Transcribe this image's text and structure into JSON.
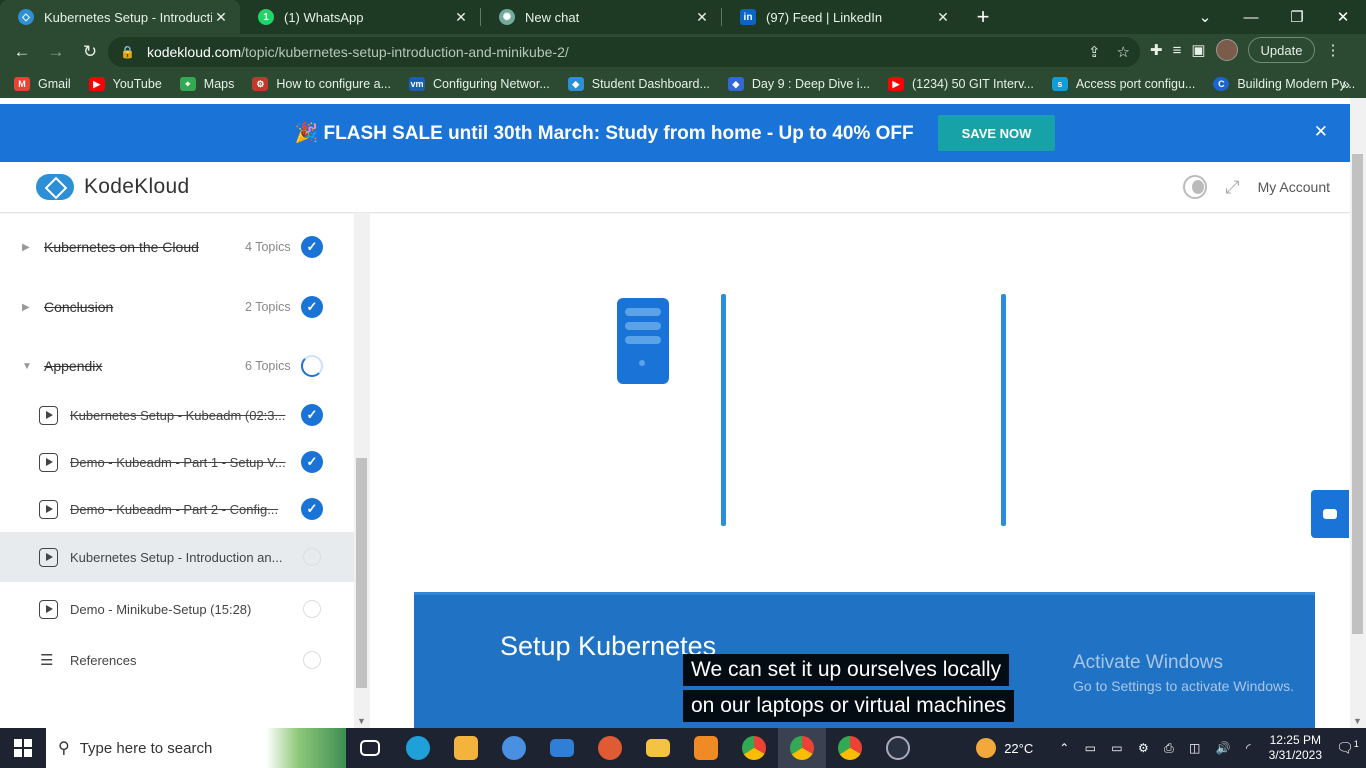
{
  "browser": {
    "tabs": [
      {
        "title": "Kubernetes Setup - Introduction",
        "favicon_color": "#2d8fd6",
        "favicon": "kodekloud-icon"
      },
      {
        "title": "(1) WhatsApp",
        "favicon_color": "#25d366",
        "favicon_text": "1"
      },
      {
        "title": "New chat",
        "favicon_color": "#74aa9c",
        "favicon": "openai-icon"
      },
      {
        "title": "(97) Feed | LinkedIn",
        "favicon_color": "#0a66c2",
        "favicon_text": "in"
      }
    ],
    "url_host": "kodekloud.com",
    "url_path": "/topic/kubernetes-setup-introduction-and-minikube-2/",
    "update_label": "Update",
    "bookmarks": [
      {
        "label": "Gmail",
        "color": "#ea4335",
        "text": "M"
      },
      {
        "label": "YouTube",
        "color": "#ff0000",
        "text": "▶"
      },
      {
        "label": "Maps",
        "color": "#34a853",
        "text": "⌖"
      },
      {
        "label": "How to configure a...",
        "color": "#c0392b",
        "text": "⚙"
      },
      {
        "label": "Configuring Networ...",
        "color": "#1a5fb4",
        "text": "vm"
      },
      {
        "label": "Student Dashboard...",
        "color": "#2d8fd6",
        "text": "◆"
      },
      {
        "label": "Day 9 : Deep Dive i...",
        "color": "#3367d6",
        "text": "◆"
      },
      {
        "label": "(1234) 50 GIT Interv...",
        "color": "#ff0000",
        "text": "▶"
      },
      {
        "label": "Access port configu...",
        "color": "#0e9ed8",
        "text": "s"
      },
      {
        "label": "Building Modern Py...",
        "color": "#1c63d4",
        "text": "C"
      }
    ]
  },
  "banner": {
    "text": "🎉 FLASH SALE until 30th March: Study from home - Up to 40% OFF",
    "button": "SAVE NOW"
  },
  "header": {
    "brand": "KodeKloud",
    "my_account": "My Account"
  },
  "sidebar": {
    "sections": [
      {
        "title": "Kubernetes on the Cloud",
        "count": "4 Topics",
        "status": "complete"
      },
      {
        "title": "Conclusion",
        "count": "2 Topics",
        "status": "complete"
      },
      {
        "title": "Appendix",
        "count": "6 Topics",
        "status": "in-progress"
      }
    ],
    "topics": [
      {
        "title": "Kubernetes Setup - Kubeadm (02:3...",
        "status": "complete"
      },
      {
        "title": "Demo - Kubeadm - Part 1 - Setup V...",
        "status": "complete"
      },
      {
        "title": "Demo - Kubeadm - Part 2 - Config...",
        "status": "complete"
      },
      {
        "title": "Kubernetes Setup - Introduction an...",
        "status": "current"
      },
      {
        "title": "Demo - Minikube-Setup (15:28)",
        "status": "incomplete"
      },
      {
        "title": "References",
        "status": "incomplete"
      }
    ]
  },
  "video": {
    "slide_title": "Setup Kubernetes",
    "caption_line1": "We can set it up ourselves locally",
    "caption_line2": "on our laptops or virtual machines",
    "watermark_title": "Activate Windows",
    "watermark_sub": "Go to Settings to activate Windows."
  },
  "taskbar": {
    "search_placeholder": "Type here to search",
    "temperature": "22°C",
    "time": "12:25 PM",
    "date": "3/31/2023",
    "notification_count": "1"
  }
}
